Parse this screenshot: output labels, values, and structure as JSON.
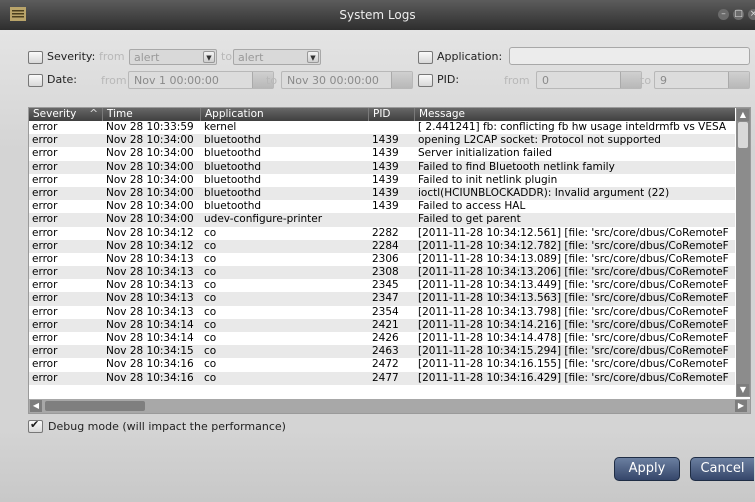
{
  "window": {
    "title": "System Logs"
  },
  "filters": {
    "severity_label": "Severity:",
    "severity_from_label": "from",
    "severity_from_value": "alert",
    "severity_to_label": "to",
    "severity_to_value": "alert",
    "date_label": "Date:",
    "date_from_label": "from",
    "date_from_value": "Nov 1 00:00:00",
    "date_to_label": "to",
    "date_to_value": "Nov 30 00:00:00",
    "application_label": "Application:",
    "application_value": "",
    "pid_label": "PID:",
    "pid_from_label": "from",
    "pid_from_value": "0",
    "pid_to_label": "to",
    "pid_to_value": "9"
  },
  "table": {
    "columns": [
      "Severity",
      "Time",
      "Application",
      "PID",
      "Message"
    ],
    "rows": [
      [
        "error",
        "Nov 28 10:33:59",
        "kernel",
        "",
        "[    2.441241] fb: conflicting fb hw usage inteldrmfb vs VESA"
      ],
      [
        "error",
        "Nov 28 10:34:00",
        "bluetoothd",
        "1439",
        "opening L2CAP socket: Protocol not supported"
      ],
      [
        "error",
        "Nov 28 10:34:00",
        "bluetoothd",
        "1439",
        "Server initialization failed"
      ],
      [
        "error",
        "Nov 28 10:34:00",
        "bluetoothd",
        "1439",
        "Failed to find Bluetooth netlink family"
      ],
      [
        "error",
        "Nov 28 10:34:00",
        "bluetoothd",
        "1439",
        "Failed to init netlink plugin"
      ],
      [
        "error",
        "Nov 28 10:34:00",
        "bluetoothd",
        "1439",
        "ioctl(HCIUNBLOCKADDR): Invalid argument (22)"
      ],
      [
        "error",
        "Nov 28 10:34:00",
        "bluetoothd",
        "1439",
        "Failed to access HAL"
      ],
      [
        "error",
        "Nov 28 10:34:00",
        "udev-configure-printer",
        "",
        "Failed to get parent"
      ],
      [
        "error",
        "Nov 28 10:34:12",
        "co",
        "2282",
        "[2011-11-28 10:34:12.561] [file: 'src/core/dbus/CoRemoteF"
      ],
      [
        "error",
        "Nov 28 10:34:12",
        "co",
        "2284",
        "[2011-11-28 10:34:12.782] [file: 'src/core/dbus/CoRemoteF"
      ],
      [
        "error",
        "Nov 28 10:34:13",
        "co",
        "2306",
        "[2011-11-28 10:34:13.089] [file: 'src/core/dbus/CoRemoteF"
      ],
      [
        "error",
        "Nov 28 10:34:13",
        "co",
        "2308",
        "[2011-11-28 10:34:13.206] [file: 'src/core/dbus/CoRemoteF"
      ],
      [
        "error",
        "Nov 28 10:34:13",
        "co",
        "2345",
        "[2011-11-28 10:34:13.449] [file: 'src/core/dbus/CoRemoteF"
      ],
      [
        "error",
        "Nov 28 10:34:13",
        "co",
        "2347",
        "[2011-11-28 10:34:13.563] [file: 'src/core/dbus/CoRemoteF"
      ],
      [
        "error",
        "Nov 28 10:34:13",
        "co",
        "2354",
        "[2011-11-28 10:34:13.798] [file: 'src/core/dbus/CoRemoteF"
      ],
      [
        "error",
        "Nov 28 10:34:14",
        "co",
        "2421",
        "[2011-11-28 10:34:14.216] [file: 'src/core/dbus/CoRemoteF"
      ],
      [
        "error",
        "Nov 28 10:34:14",
        "co",
        "2426",
        "[2011-11-28 10:34:14.478] [file: 'src/core/dbus/CoRemoteF"
      ],
      [
        "error",
        "Nov 28 10:34:15",
        "co",
        "2463",
        "[2011-11-28 10:34:15.294] [file: 'src/core/dbus/CoRemoteF"
      ],
      [
        "error",
        "Nov 28 10:34:16",
        "co",
        "2472",
        "[2011-11-28 10:34:16.155] [file: 'src/core/dbus/CoRemoteF"
      ],
      [
        "error",
        "Nov 28 10:34:16",
        "co",
        "2477",
        "[2011-11-28 10:34:16.429] [file: 'src/core/dbus/CoRemoteF"
      ]
    ]
  },
  "debug": {
    "label": "Debug mode (will impact the performance)",
    "checked": true
  },
  "buttons": {
    "apply": "Apply",
    "cancel": "Cancel"
  },
  "icons": {
    "app": "log-icon",
    "minimize": "minimize-icon",
    "maximize": "maximize-icon",
    "close": "close-icon"
  }
}
